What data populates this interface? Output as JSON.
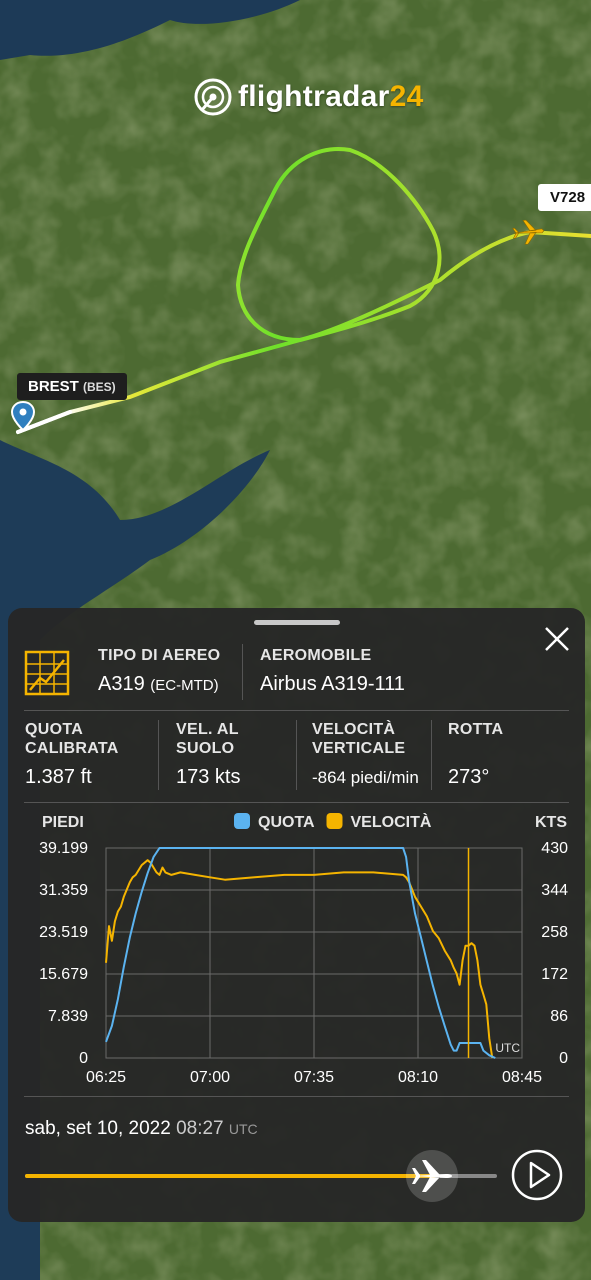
{
  "map": {
    "logo": {
      "text": "flightradar",
      "num": "24"
    },
    "airport": {
      "name": "BREST",
      "code": "(BES)"
    },
    "flight_label": "V728"
  },
  "panel": {
    "type_label": "TIPO DI AEREO",
    "type_value": "A319",
    "type_reg": "(EC-MTD)",
    "aircraft_label": "AEROMOBILE",
    "aircraft_value": "Airbus A319-111",
    "stats": [
      {
        "label1": "QUOTA",
        "label2": "CALIBRATA",
        "value": "1.387 ft"
      },
      {
        "label1": "VEL. AL",
        "label2": "SUOLO",
        "value": "173 kts"
      },
      {
        "label1": "VELOCITÀ",
        "label2": "VERTICALE",
        "value": "-864 piedi/min"
      },
      {
        "label1": "ROTTA",
        "label2": "",
        "value": "273°"
      }
    ],
    "date": "sab, set 10, 2022",
    "time": "08:27",
    "tz": "UTC"
  },
  "chart_data": {
    "type": "line",
    "left_unit": "PIEDI",
    "right_unit": "KTS",
    "legend": [
      {
        "name": "QUOTA",
        "color": "#5bb3f0"
      },
      {
        "name": "VELOCITÀ",
        "color": "#f5b400"
      }
    ],
    "y_left_ticks": [
      "39.199",
      "31.359",
      "23.519",
      "15.679",
      "7.839",
      "0"
    ],
    "y_right_ticks": [
      "430",
      "344",
      "258",
      "172",
      "86",
      "0"
    ],
    "x_ticks": [
      "06:25",
      "07:00",
      "07:35",
      "08:10",
      "08:45"
    ],
    "ylim_left": [
      0,
      39199
    ],
    "ylim_right": [
      0,
      430
    ],
    "xlim_min": [
      0,
      140
    ],
    "cursor_min": 122,
    "cursor_label": "UTC",
    "series": [
      {
        "name": "QUOTA",
        "axis": "left",
        "x": [
          0,
          2,
          4,
          6,
          8,
          10,
          12,
          14,
          16,
          18,
          19,
          20,
          30,
          40,
          60,
          80,
          90,
          100,
          101,
          102,
          104,
          106,
          108,
          110,
          112,
          114,
          116,
          117,
          118,
          119,
          120,
          122,
          126,
          127,
          129,
          131
        ],
        "y": [
          3000,
          6000,
          11000,
          17000,
          22500,
          27000,
          31000,
          34500,
          37500,
          39200,
          39200,
          39200,
          39200,
          39200,
          39200,
          39200,
          39200,
          39200,
          37500,
          33000,
          27000,
          22500,
          18000,
          13500,
          9500,
          6000,
          2500,
          1387,
          1387,
          2800,
          2800,
          2800,
          2800,
          1387,
          500,
          0
        ]
      },
      {
        "name": "VELOCITÀ",
        "axis": "right",
        "x": [
          0,
          1,
          2,
          3,
          4,
          5,
          6,
          7,
          8,
          9,
          10,
          12,
          14,
          15,
          16,
          17,
          18,
          19,
          20,
          22,
          25,
          30,
          35,
          40,
          50,
          60,
          70,
          80,
          90,
          100,
          101,
          102,
          103,
          104,
          106,
          108,
          110,
          112,
          114,
          116,
          117,
          118,
          119,
          120,
          121,
          122,
          123,
          124,
          125,
          126,
          127,
          128,
          129,
          130
        ],
        "y": [
          195,
          270,
          240,
          280,
          300,
          310,
          330,
          345,
          360,
          370,
          375,
          395,
          405,
          400,
          390,
          380,
          375,
          390,
          380,
          375,
          380,
          375,
          370,
          365,
          370,
          375,
          375,
          380,
          380,
          375,
          370,
          360,
          345,
          330,
          310,
          290,
          260,
          245,
          220,
          200,
          185,
          173,
          150,
          200,
          230,
          230,
          235,
          230,
          200,
          150,
          130,
          110,
          40,
          0
        ]
      }
    ]
  }
}
